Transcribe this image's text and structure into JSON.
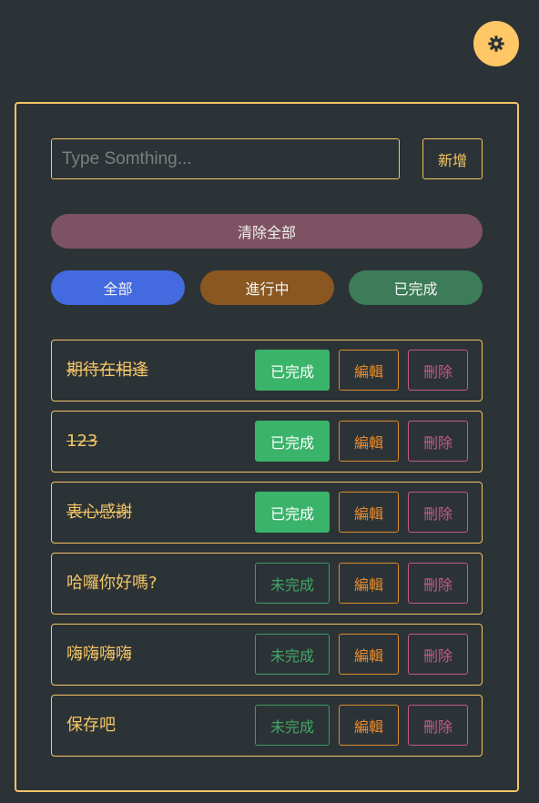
{
  "theme_toggle": {
    "icon": "gear-icon"
  },
  "input": {
    "placeholder": "Type Somthing...",
    "value": ""
  },
  "add_button_label": "新增",
  "clear_all_label": "清除全部",
  "filters": {
    "all": "全部",
    "in_progress": "進行中",
    "completed": "已完成"
  },
  "todos": [
    {
      "text": "期待在相逢",
      "done": true,
      "status_label": "已完成",
      "edit_label": "編輯",
      "delete_label": "刪除"
    },
    {
      "text": "123",
      "done": true,
      "status_label": "已完成",
      "edit_label": "編輯",
      "delete_label": "刪除"
    },
    {
      "text": "衷心感謝",
      "done": true,
      "status_label": "已完成",
      "edit_label": "編輯",
      "delete_label": "刪除"
    },
    {
      "text": "哈囉你好嗎?",
      "done": false,
      "status_label": "未完成",
      "edit_label": "編輯",
      "delete_label": "刪除"
    },
    {
      "text": "嗨嗨嗨嗨",
      "done": false,
      "status_label": "未完成",
      "edit_label": "編輯",
      "delete_label": "刪除"
    },
    {
      "text": "保存吧",
      "done": false,
      "status_label": "未完成",
      "edit_label": "編輯",
      "delete_label": "刪除"
    }
  ],
  "colors": {
    "background": "#2c3336",
    "accent": "#f4c566",
    "toggle": "#ffc766",
    "clear_all": "#7d5262",
    "filter_all": "#436bdf",
    "filter_in_progress": "#8a5720",
    "filter_completed": "#3c7c58",
    "complete_button": "#3ab46a",
    "edit": "#e88b2c",
    "delete": "#c25b86"
  }
}
